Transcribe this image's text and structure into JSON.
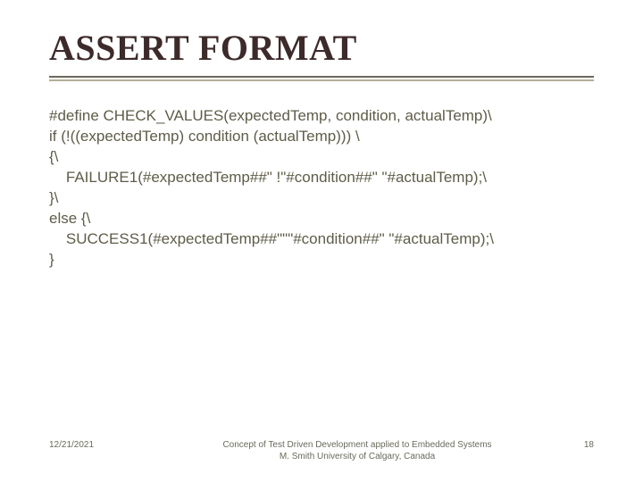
{
  "title": "ASSERT FORMAT",
  "code": {
    "l1": "#define CHECK_VALUES(expectedTemp, condition, actualTemp)\\",
    "l2": "if (!((expectedTemp) condition (actualTemp))) \\",
    "l3": "{\\",
    "l4": "    FAILURE1(#expectedTemp##\" !\"#condition##\" \"#actualTemp);\\",
    "l5": "}\\",
    "l6": "else {\\",
    "l7": "    SUCCESS1(#expectedTemp##\"\"\"#condition##\" \"#actualTemp);\\",
    "l8": "}"
  },
  "footer": {
    "date": "12/21/2021",
    "center_line1": "Concept of Test Driven Development applied to Embedded Systems",
    "center_line2": "M. Smith University of Calgary, Canada",
    "page": "18"
  }
}
